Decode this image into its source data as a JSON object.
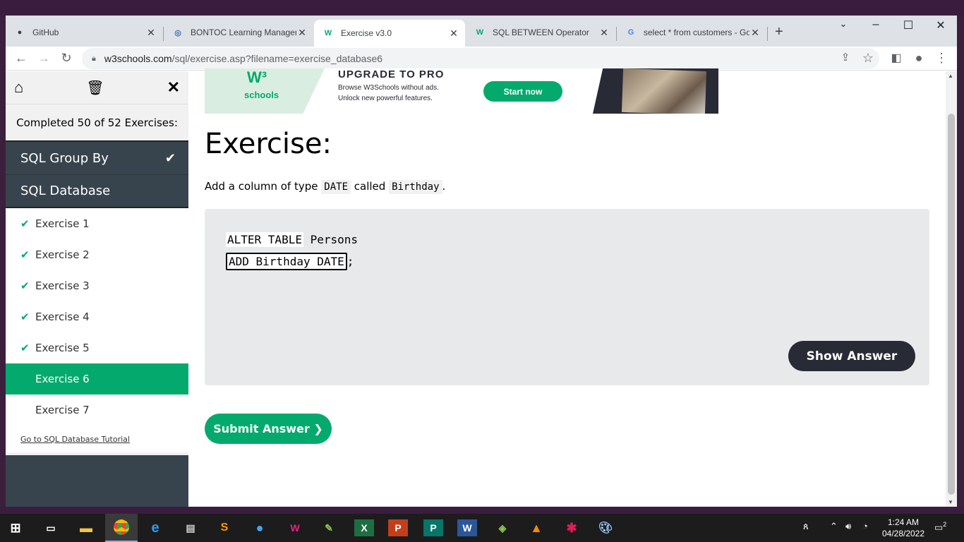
{
  "browser": {
    "tabs": [
      {
        "title": "GitHub",
        "favicon": "github-icon"
      },
      {
        "title": "BONTOC Learning Managen",
        "favicon": "lms-icon"
      },
      {
        "title": "Exercise v3.0",
        "favicon": "w3schools-icon",
        "active": true
      },
      {
        "title": "SQL BETWEEN Operator",
        "favicon": "w3schools-icon"
      },
      {
        "title": "select * from customers - Go",
        "favicon": "google-icon"
      }
    ],
    "url_host": "w3schools.com",
    "url_path": "/sql/exercise.asp?filename=exercise_database6"
  },
  "sidebar": {
    "completed": "Completed 50 of 52 Exercises:",
    "prev_group": "SQL Group By",
    "current_group": "SQL Database",
    "items": [
      {
        "label": "Exercise 1",
        "done": true
      },
      {
        "label": "Exercise 2",
        "done": true
      },
      {
        "label": "Exercise 3",
        "done": true
      },
      {
        "label": "Exercise 4",
        "done": true
      },
      {
        "label": "Exercise 5",
        "done": true
      },
      {
        "label": "Exercise 6",
        "done": false,
        "active": true
      },
      {
        "label": "Exercise 7",
        "done": false
      }
    ],
    "tutorial_link": "Go to SQL Database Tutorial"
  },
  "ad": {
    "logo": "schools",
    "headline": "UPGRADE TO PRO",
    "line1": "Browse W3Schools without ads.",
    "line2": "Unlock new powerful features.",
    "button": "Start now"
  },
  "exercise": {
    "title": "Exercise:",
    "desc_pre": "Add a column of type",
    "desc_type": "DATE",
    "desc_mid": "called",
    "desc_name": "Birthday",
    "desc_end": ".",
    "code_kw": "ALTER TABLE",
    "code_table": "Persons",
    "answer_value": "ADD Birthday DATE",
    "code_end": ";",
    "show_answer": "Show Answer",
    "submit": "Submit Answer ❯"
  },
  "taskbar": {
    "time": "1:24 AM",
    "date": "04/28/2022",
    "notifications": "2"
  },
  "colors": {
    "accent": "#04aa6d",
    "sidebar_dark": "#38444d",
    "code_bg": "#e7e9eb",
    "dark_button": "#282a35"
  }
}
